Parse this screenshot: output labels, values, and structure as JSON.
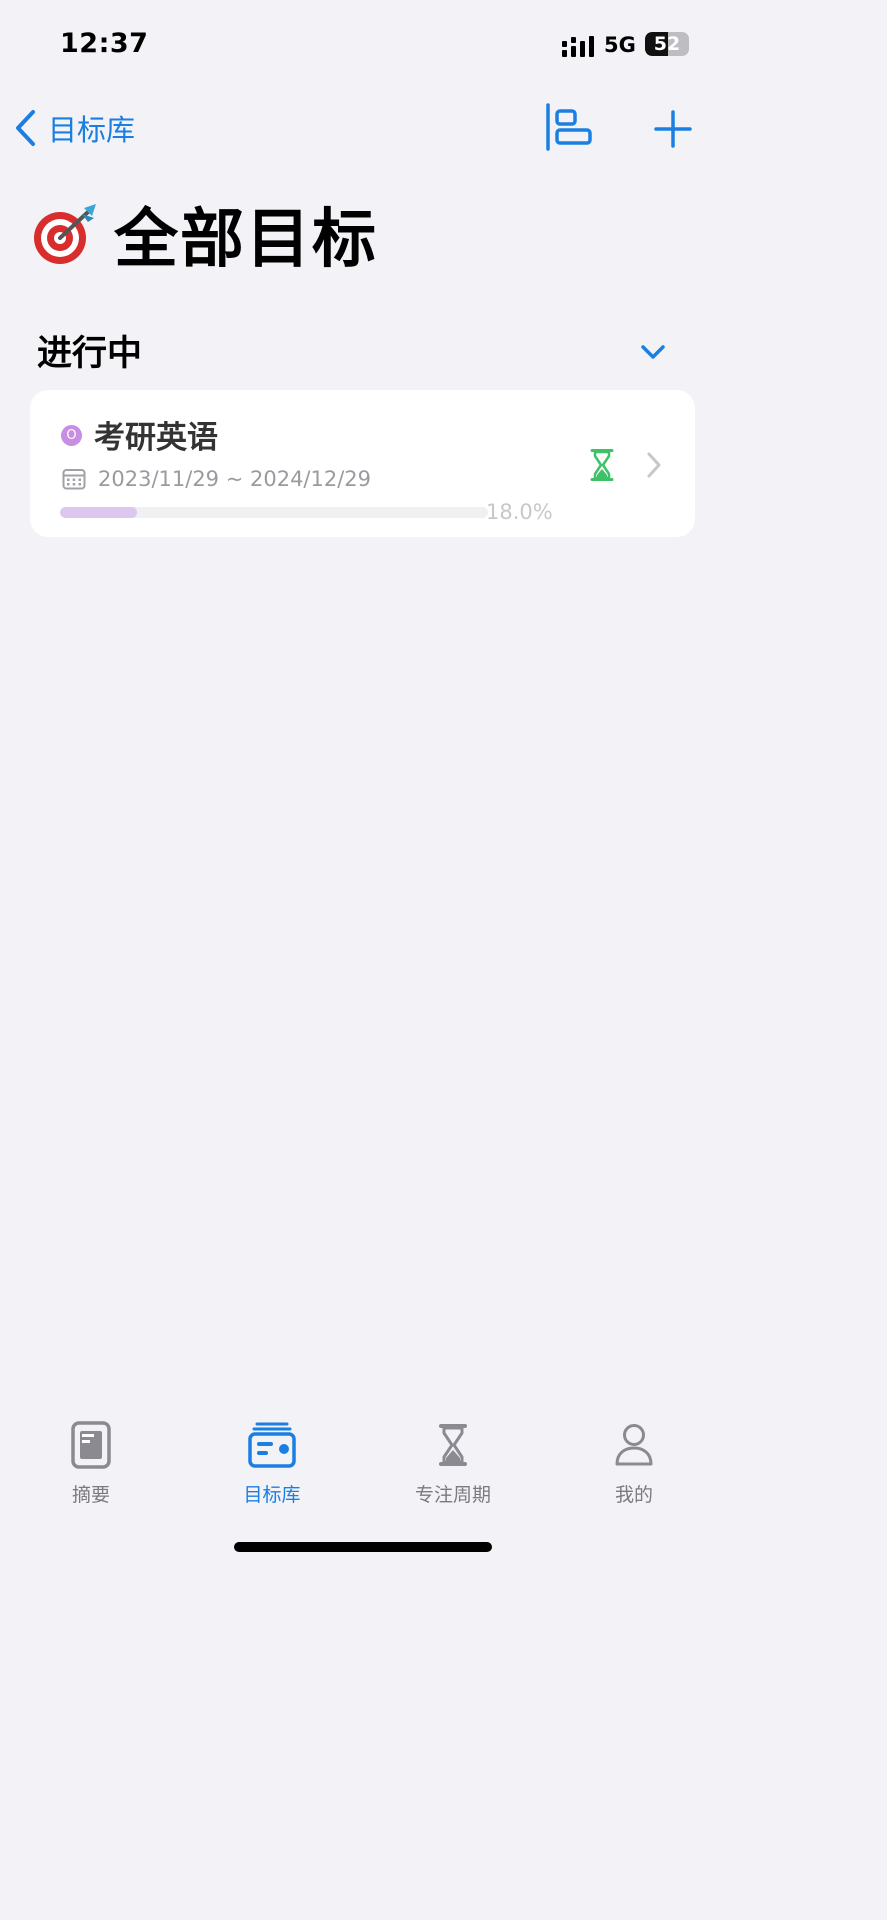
{
  "status_bar": {
    "time": "12:37",
    "network": "5G",
    "battery_level": "52",
    "battery_fraction": 0.52
  },
  "nav": {
    "back_label": "目标库",
    "back_icon": "chevron-left-icon",
    "layout_icon": "layout-list-icon",
    "add_icon": "plus-icon",
    "accent_color": "#1a7fe0"
  },
  "page": {
    "title_emoji": "🎯",
    "title": "全部目标"
  },
  "section": {
    "title": "进行中",
    "toggle_icon": "chevron-down-icon"
  },
  "goals": [
    {
      "dot_letter": "O",
      "dot_color": "#c78ee4",
      "name": "考研英语",
      "dates": "2023/11/29 ~ 2024/12/29",
      "progress_text": "18.0%",
      "progress_fraction": 0.18,
      "progress_color": "#dcc8ef",
      "status_icon": "hourglass-icon",
      "status_color": "#3ec267"
    }
  ],
  "tabs": [
    {
      "label": "摘要",
      "icon": "summary-icon",
      "active": false
    },
    {
      "label": "目标库",
      "icon": "goal-library-icon",
      "active": true
    },
    {
      "label": "专注周期",
      "icon": "hourglass-icon",
      "active": false
    },
    {
      "label": "我的",
      "icon": "person-icon",
      "active": false
    }
  ]
}
